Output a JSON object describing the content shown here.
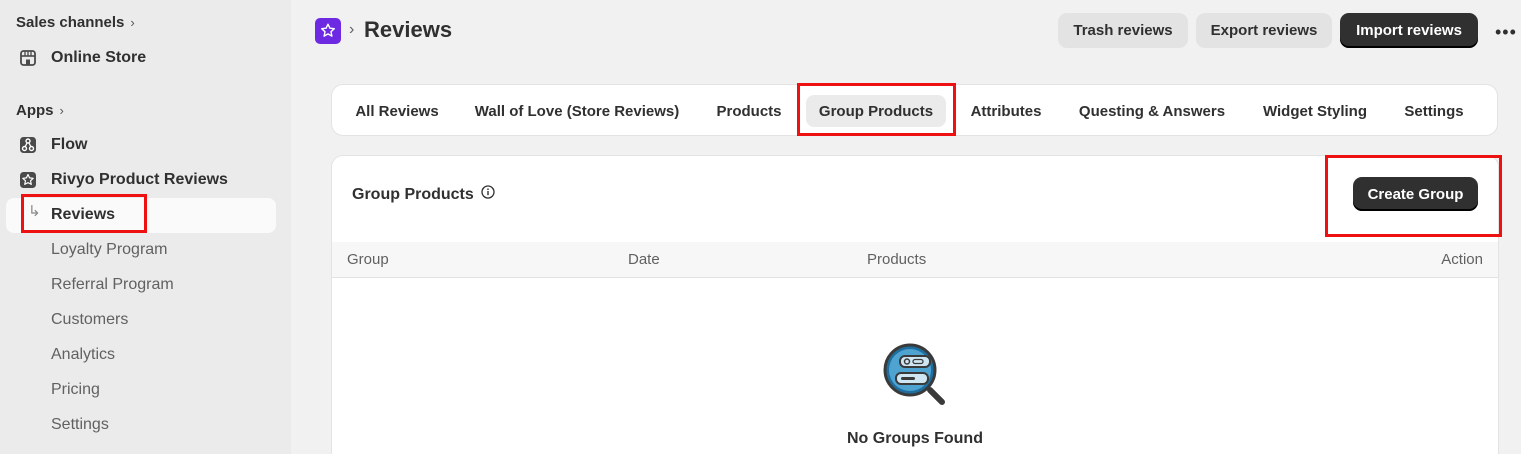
{
  "sidebar": {
    "sales_channels_label": "Sales channels",
    "online_store_label": "Online Store",
    "apps_label": "Apps",
    "flow_label": "Flow",
    "app_name": "Rivyo Product Reviews",
    "active_item": "Reviews",
    "sub_items": [
      "Loyalty Program",
      "Referral Program",
      "Customers",
      "Analytics",
      "Pricing",
      "Settings"
    ]
  },
  "header": {
    "title": "Reviews",
    "buttons": {
      "trash": "Trash reviews",
      "export": "Export reviews",
      "import": "Import reviews"
    },
    "more_icon": "ellipsis-horizontal-icon"
  },
  "tabs": [
    "All Reviews",
    "Wall of Love (Store Reviews)",
    "Products",
    "Group Products",
    "Attributes",
    "Questing & Answers",
    "Widget Styling",
    "Settings"
  ],
  "active_tab": "Group Products",
  "group_products": {
    "title": "Group Products",
    "create_button": "Create Group",
    "columns": [
      "Group",
      "Date",
      "Products",
      "Action"
    ],
    "empty_text": "No Groups Found"
  },
  "colors": {
    "brand": "#6d2ae2",
    "highlight": "#ee1111",
    "primary_button": "#303030"
  }
}
